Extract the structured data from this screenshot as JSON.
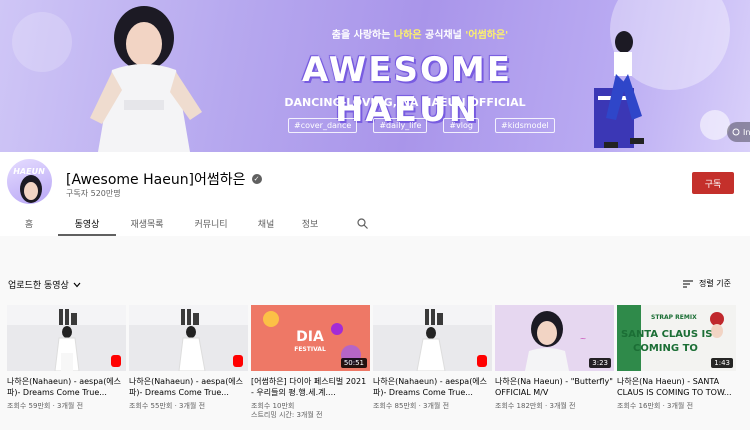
{
  "banner": {
    "tagline_prefix": "춤을 사랑하는 ",
    "tagline_name": "나하은",
    "tagline_mid": " 공식채널 ",
    "tagline_quote": "'어썸하은'",
    "title": "AWESOME HAEUN",
    "subtitle": "DANCING-LOVING, NA HAEUN OFFICIAL",
    "hashtags": [
      "#cover_dance",
      "#daily_life",
      "#vlog",
      "#kidsmodel"
    ],
    "link_label": "In"
  },
  "avatar": {
    "text": "HAEUN"
  },
  "channel": {
    "name": "[Awesome Haeun]어썸하은",
    "verified_mark": "✓",
    "subscribers": "구독자 520만명",
    "subscribe_label": "구독"
  },
  "tabs": [
    {
      "label": "홈",
      "active": false
    },
    {
      "label": "동영상",
      "active": true
    },
    {
      "label": "재생목록",
      "active": false
    },
    {
      "label": "커뮤니티",
      "active": false
    },
    {
      "label": "채널",
      "active": false
    },
    {
      "label": "정보",
      "active": false
    }
  ],
  "content": {
    "uploads_label": "업로드한 동영상",
    "sort_label": "정렬 기준"
  },
  "videos": [
    {
      "title": "나하은(Nahaeun) - aespa(에스파)- Dreams Come True...",
      "views": "조회수 59만회",
      "age": "3개월 전",
      "extra": "",
      "duration": "",
      "shorts": true,
      "style": "studio"
    },
    {
      "title": "나하은(Nahaeun) - aespa(에스파)- Dreams Come True...",
      "views": "조회수 55만회",
      "age": "3개월 전",
      "extra": "",
      "duration": "",
      "shorts": true,
      "style": "studio"
    },
    {
      "title": "[어썸하은] 다이아 페스티벌 2021 - 우리들의 평.행.세.계....",
      "views": "조회수 10만회",
      "age": "",
      "extra": "스트리밍 시간: 3개월 전",
      "duration": "50:51",
      "shorts": false,
      "style": "festival"
    },
    {
      "title": "나하은(Nahaeun) - aespa(에스파)- Dreams Come True...",
      "views": "조회수 85만회",
      "age": "3개월 전",
      "extra": "",
      "duration": "",
      "shorts": true,
      "style": "studio"
    },
    {
      "title": "나하은(Na Haeun) - \"Butterfly\" OFFICIAL M/V",
      "views": "조회수 182만회",
      "age": "3개월 전",
      "extra": "",
      "duration": "3:23",
      "shorts": false,
      "style": "butterfly"
    },
    {
      "title": "나하은(Na Haeun) - SANTA CLAUS IS COMING TO TOW...",
      "views": "조회수 16만회",
      "age": "3개월 전",
      "extra": "",
      "duration": "1:43",
      "shorts": false,
      "style": "santa",
      "thumb_text": {
        "top": "STRAP REMIX",
        "line1": "SANTA CLAUS IS",
        "line2": "COMING TO"
      }
    }
  ],
  "festival_thumb": {
    "logo": "DIA",
    "sub": "FESTIVAL"
  },
  "colors": {
    "subscribe": "#c4302b",
    "banner_accent": "#a995ea",
    "duration_bg": "#000000"
  },
  "icons": [
    "verified-icon",
    "search-icon",
    "chevron-down-icon",
    "sort-icon",
    "shorts-icon",
    "link-icon"
  ]
}
